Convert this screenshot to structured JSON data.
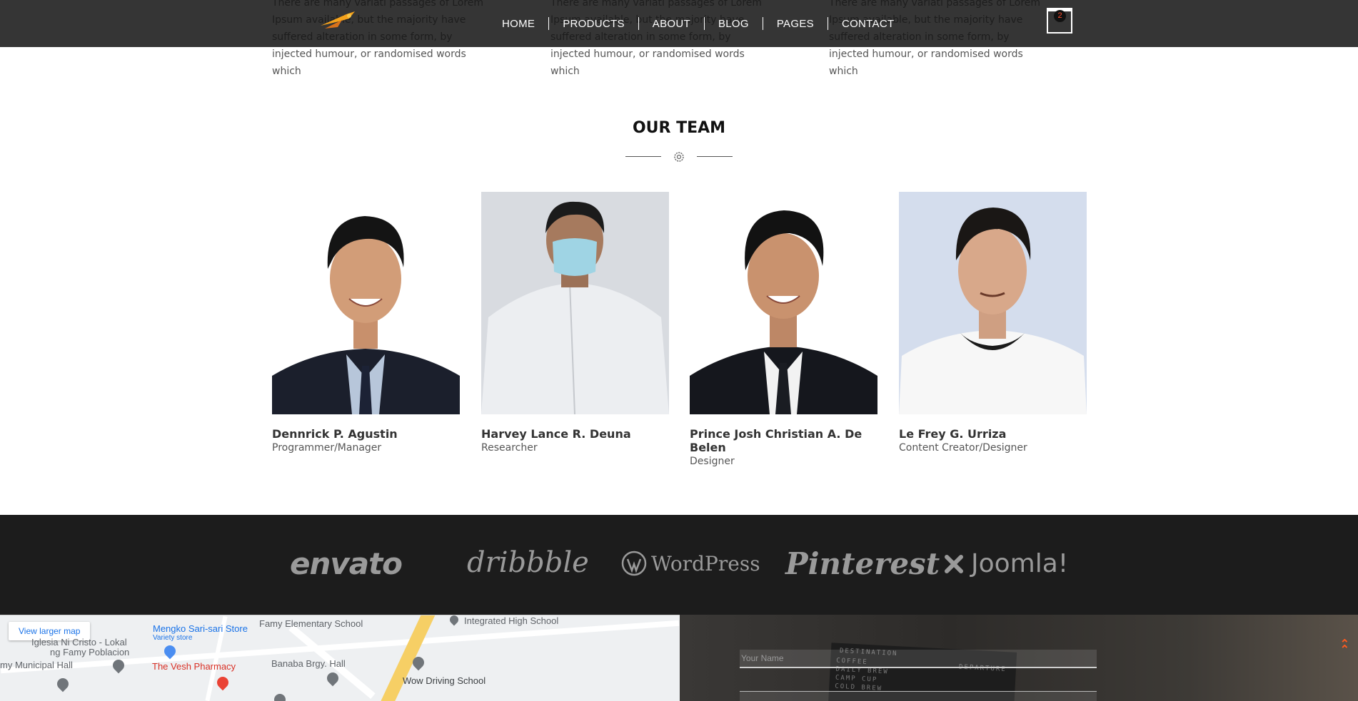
{
  "features": [
    {
      "text": "There are many variati passages of Lorem Ipsum available, but the majority have suffered alteration in some form, by injected humour, or randomised words which"
    },
    {
      "text": "There are many variati passages of Lorem Ipsum available, but the majority have suffered alteration in some form, by injected humour, or randomised words which"
    },
    {
      "text": "There are many variati passages of Lorem Ipsum available, but the majority have suffered alteration in some form, by injected humour, or randomised words which"
    }
  ],
  "header": {
    "nav": [
      "HOME",
      "PRODUCTS",
      "ABOUT",
      "BLOG",
      "PAGES",
      "CONTACT"
    ],
    "cart_count": "2"
  },
  "team": {
    "title": "OUR TEAM",
    "members": [
      {
        "name": "Dennrick P. Agustin",
        "role": "Programmer/Manager"
      },
      {
        "name": "Harvey Lance R. Deuna",
        "role": "Researcher"
      },
      {
        "name": "Prince Josh Christian A. De Belen",
        "role": "Designer"
      },
      {
        "name": "Le Frey G. Urriza",
        "role": "Content Creator/Designer"
      }
    ]
  },
  "brands": [
    "envato",
    "dribbble",
    "WordPress",
    "Pinterest",
    "Joomla!"
  ],
  "map": {
    "button": "View larger map",
    "labels": {
      "store": "Mengko Sari-sari Store",
      "store_type": "Variety store",
      "school1": "Famy Elementary School",
      "school2": "Integrated High School",
      "church1": "Iglesia Ni Cristo - Lokal",
      "church2": "ng Famy Poblacion",
      "hall1": "my Municipal Hall",
      "pharmacy": "The Vesh Pharmacy",
      "hall2": "Banaba Brgy. Hall",
      "driving": "Wow Driving School"
    }
  },
  "contact": {
    "name_placeholder": "Your Name",
    "board": [
      "DESTINATION",
      "COFFEE",
      "DAILY BREW",
      "CAMP CUP",
      "COLD BREW",
      "DEPARTURE"
    ]
  },
  "colors": {
    "accent": "#ff5a1f",
    "header_bg": "#141414",
    "footer_bg": "#1c1c1c"
  }
}
